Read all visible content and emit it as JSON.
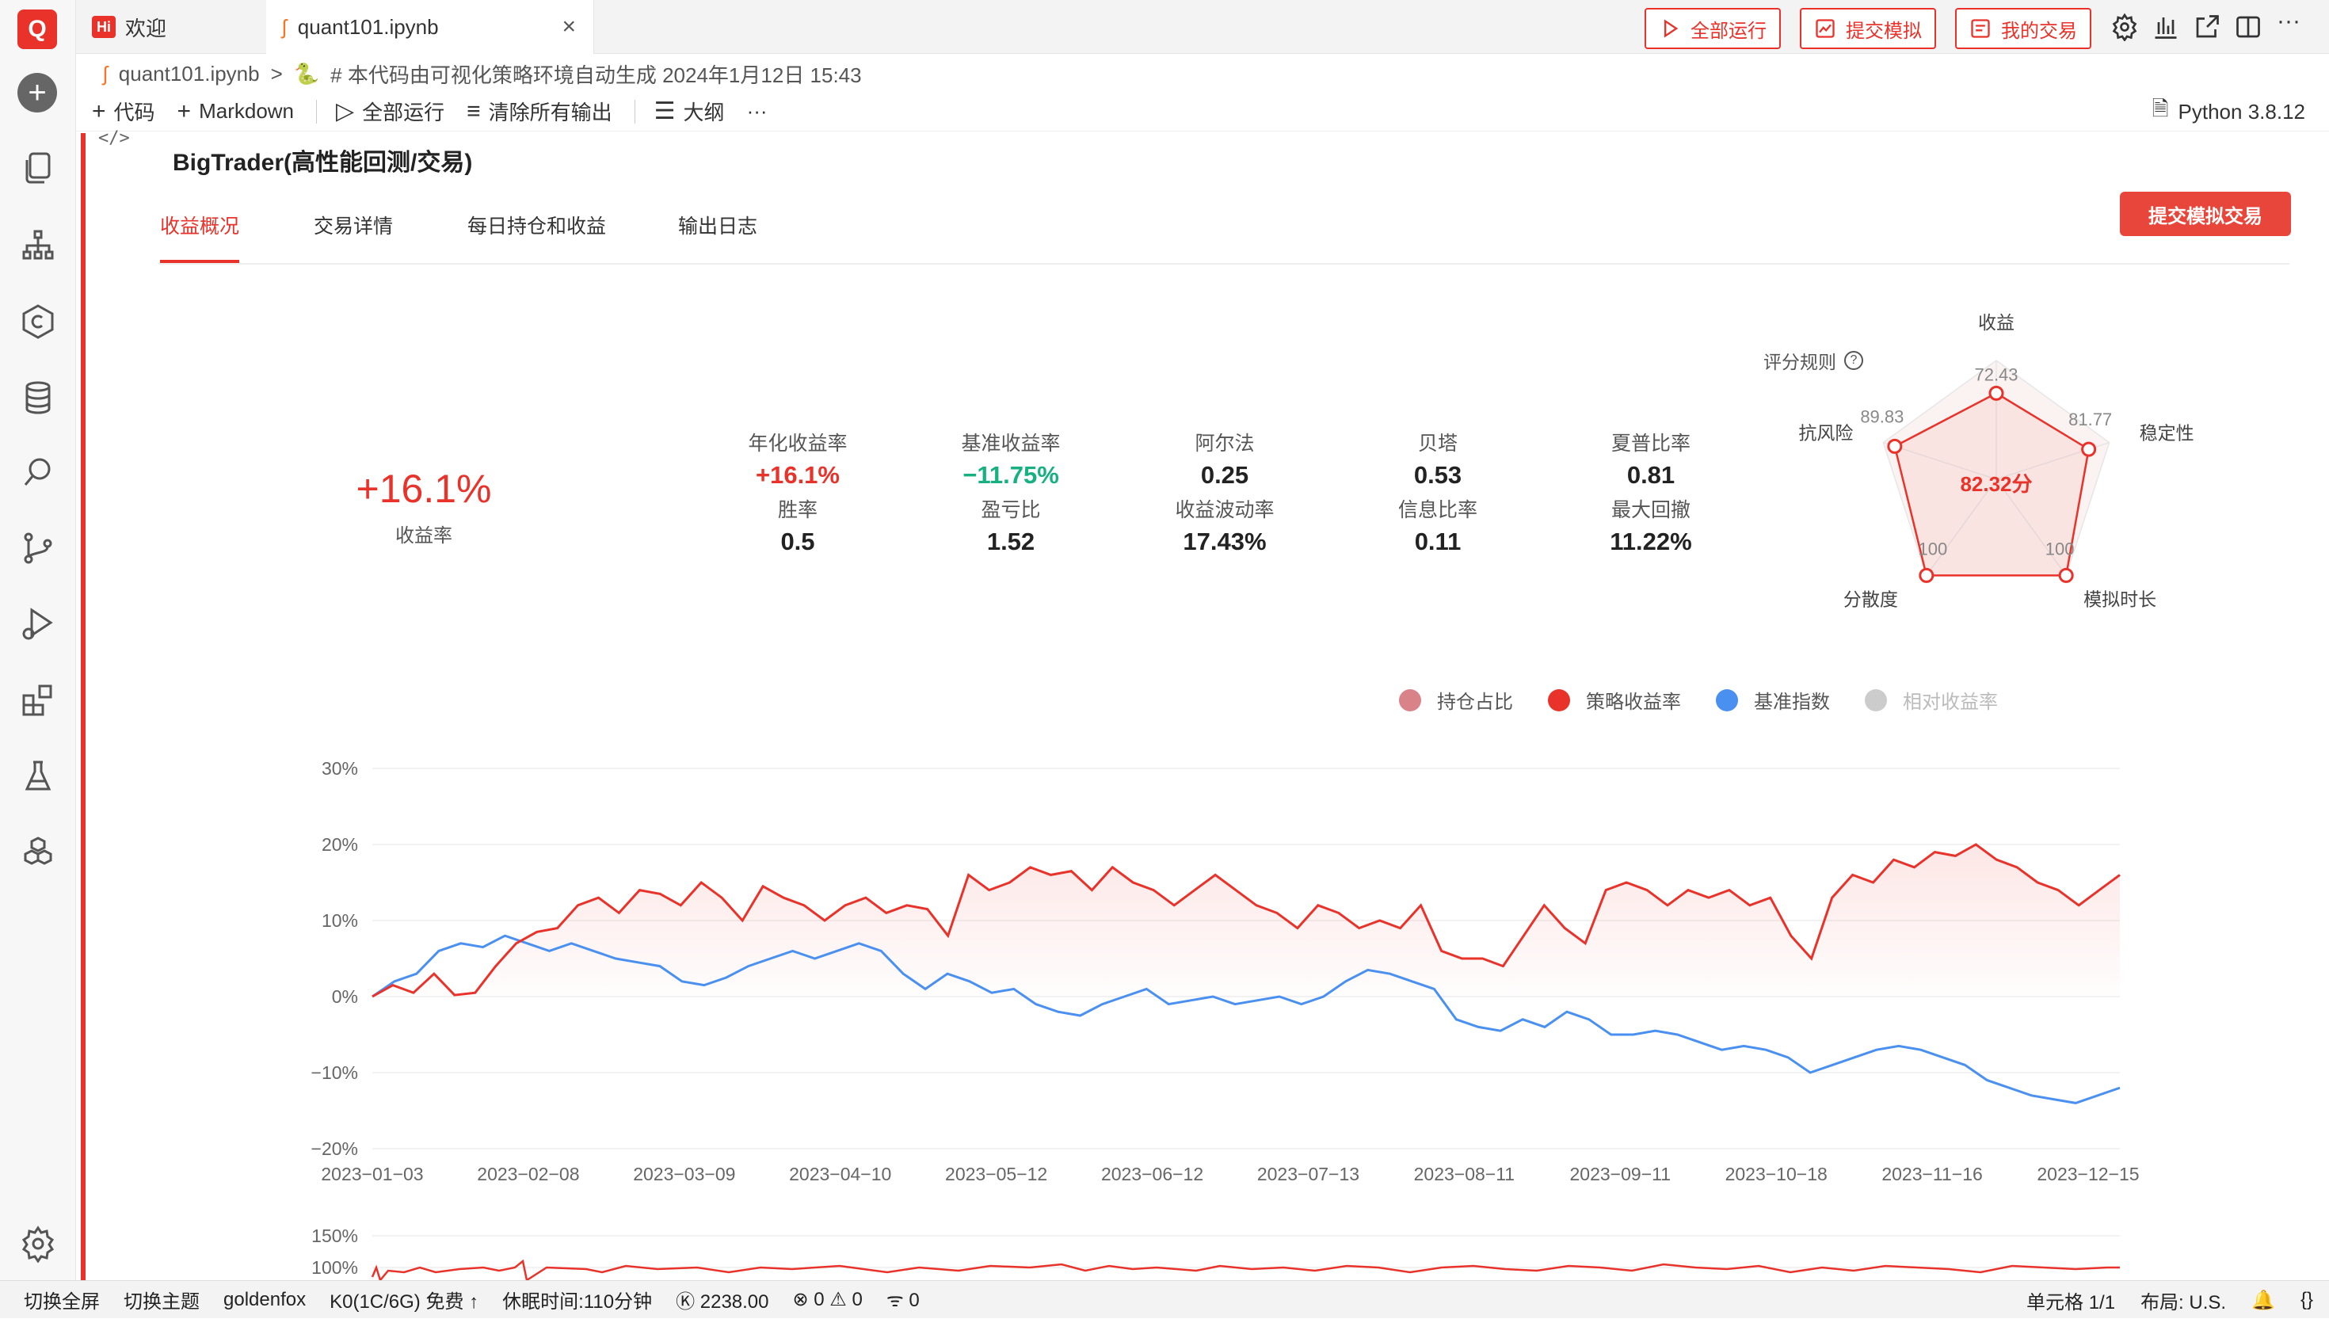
{
  "app": {
    "logo_text": "Q",
    "brand_color": "#e8322a"
  },
  "tabs": [
    {
      "badge": "Hi",
      "label": "欢迎"
    },
    {
      "label": "quant101.ipynb",
      "close": "×"
    }
  ],
  "top_actions": {
    "run_all": "全部运行",
    "submit_sim": "提交模拟",
    "my_trades": "我的交易"
  },
  "breadcrumb": {
    "file": "quant101.ipynb",
    "sep": ">",
    "section": "# 本代码由可视化策略环境自动生成 2024年1月12日 15:43"
  },
  "toolbar": {
    "code": "代码",
    "markdown": "Markdown",
    "run_all": "全部运行",
    "clear_outputs": "清除所有输出",
    "outline": "大纲",
    "more": "···",
    "kernel": "Python 3.8.12"
  },
  "cell": {
    "code_toggle": "</>",
    "title": "BigTrader(高性能回测/交易)",
    "subtabs": [
      "收益概况",
      "交易详情",
      "每日持仓和收益",
      "输出日志"
    ],
    "submit_button": "提交模拟交易"
  },
  "summary": {
    "total_return": "+16.1%",
    "total_return_label": "收益率",
    "metrics_row1": [
      {
        "label": "年化收益率",
        "value": "+16.1%",
        "tone": "red"
      },
      {
        "label": "基准收益率",
        "value": "−11.75%",
        "tone": "green"
      },
      {
        "label": "阿尔法",
        "value": "0.25",
        "tone": ""
      },
      {
        "label": "贝塔",
        "value": "0.53",
        "tone": ""
      },
      {
        "label": "夏普比率",
        "value": "0.81",
        "tone": ""
      }
    ],
    "metrics_row2": [
      {
        "label": "胜率",
        "value": "0.5"
      },
      {
        "label": "盈亏比",
        "value": "1.52"
      },
      {
        "label": "收益波动率",
        "value": "17.43%"
      },
      {
        "label": "信息比率",
        "value": "0.11"
      },
      {
        "label": "最大回撤",
        "value": "11.22%"
      }
    ]
  },
  "radar": {
    "score_rule": "评分规则",
    "score": "82.32分",
    "axes": [
      {
        "name": "收益",
        "value": 72.43,
        "label": "72.43"
      },
      {
        "name": "稳定性",
        "value": 81.77,
        "label": "81.77"
      },
      {
        "name": "模拟时长",
        "value": 100,
        "label": "100"
      },
      {
        "name": "分散度",
        "value": 100,
        "label": "100"
      },
      {
        "name": "抗风险",
        "value": 89.83,
        "label": "89.83"
      }
    ]
  },
  "chart_data": {
    "type": "line",
    "legend": [
      {
        "name": "持仓占比",
        "color": "#d98389",
        "active": true
      },
      {
        "name": "策略收益率",
        "color": "#e8322a",
        "active": true
      },
      {
        "name": "基准指数",
        "color": "#4a90f0",
        "active": true
      },
      {
        "name": "相对收益率",
        "color": "#cccccc",
        "active": false
      }
    ],
    "ylim": [
      -20,
      30
    ],
    "yticks": [
      "30%",
      "20%",
      "10%",
      "0%",
      "−10%",
      "−20%"
    ],
    "x_ticks": [
      "2023−01−03",
      "2023−02−08",
      "2023−03−09",
      "2023−04−10",
      "2023−05−12",
      "2023−06−12",
      "2023−07−13",
      "2023−08−11",
      "2023−09−11",
      "2023−10−18",
      "2023−11−16",
      "2023−12−15"
    ],
    "series": [
      {
        "name": "策略收益率",
        "color": "#e8322a",
        "values": [
          0,
          1.5,
          0.5,
          3,
          0.2,
          0.5,
          4,
          7,
          8.5,
          9,
          12,
          13,
          11,
          14,
          13.5,
          12,
          15,
          13,
          10,
          14.5,
          13,
          12,
          10,
          12,
          13,
          11,
          12,
          11.5,
          8,
          16,
          14,
          15,
          17,
          16,
          16.5,
          14,
          17,
          15,
          14,
          12,
          14,
          16,
          14,
          12,
          11,
          9,
          12,
          11,
          9,
          10,
          9,
          12,
          6,
          5,
          5,
          4,
          8,
          12,
          9,
          7,
          14,
          15,
          14,
          12,
          14,
          13,
          14,
          12,
          13,
          8,
          5,
          13,
          16,
          15,
          18,
          17,
          19,
          18.5,
          20,
          18,
          17,
          15,
          14,
          12,
          14,
          16
        ]
      },
      {
        "name": "基准指数",
        "color": "#4a90f0",
        "values": [
          0,
          2,
          3,
          6,
          7,
          6.5,
          8,
          7,
          6,
          7,
          6,
          5,
          4.5,
          4,
          2,
          1.5,
          2.5,
          4,
          5,
          6,
          5,
          6,
          7,
          6,
          3,
          1,
          3,
          2,
          0.5,
          1,
          -1,
          -2,
          -2.5,
          -1,
          0,
          1,
          -1,
          -0.5,
          0,
          -1,
          -0.5,
          0,
          -1,
          0,
          2,
          3.5,
          3,
          2,
          1,
          -3,
          -4,
          -4.5,
          -3,
          -4,
          -2,
          -3,
          -5,
          -5,
          -4.5,
          -5,
          -6,
          -7,
          -6.5,
          -7,
          -8,
          -10,
          -9,
          -8,
          -7,
          -6.5,
          -7,
          -8,
          -9,
          -11,
          -12,
          -13,
          -13.5,
          -14,
          -13,
          -12
        ]
      },
      {
        "name": "持仓占比",
        "color": "#e8322a",
        "values": []
      }
    ],
    "sub_yticks": [
      "150%",
      "100%"
    ]
  },
  "status_bar": {
    "fullscreen": "切换全屏",
    "theme": "切换主题",
    "user": "goldenfox",
    "kernel": "K0(1C/6G) 免费 ↑",
    "sleep": "休眠时间:110分钟",
    "credits": "Ⓚ 2238.00",
    "errors": "⊗ 0 ⚠ 0",
    "ports": "ᯤ 0",
    "cell_pos": "单元格 1/1",
    "layout": "布局: U.S.",
    "bell": "🔔",
    "braces": "{}"
  }
}
